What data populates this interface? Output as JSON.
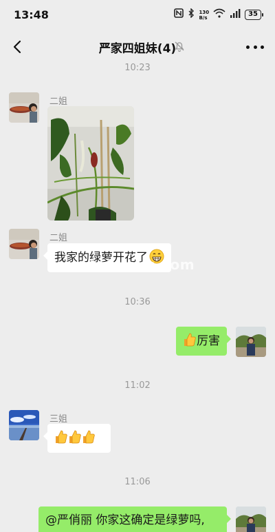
{
  "status_bar": {
    "time": "13:48",
    "speed_value": "130",
    "speed_unit": "B/s",
    "battery": "35"
  },
  "nav": {
    "title": "严家四姐妹(4)"
  },
  "messages": {
    "ts1": "10:23",
    "m1_sender": "二姐",
    "m2_sender": "二姐",
    "m2_text": "我家的绿萝开花了",
    "ts2": "10:36",
    "m3_text": "厉害",
    "ts3": "11:02",
    "m4_sender": "三姐",
    "ts4": "11:06",
    "m5_text": "@严俏丽  你家这确定是绿萝吗,"
  },
  "watermark": "tuhuaba.com",
  "colors": {
    "background": "#ededed",
    "outgoing_bubble": "#95ec69",
    "incoming_bubble": "#ffffff"
  }
}
